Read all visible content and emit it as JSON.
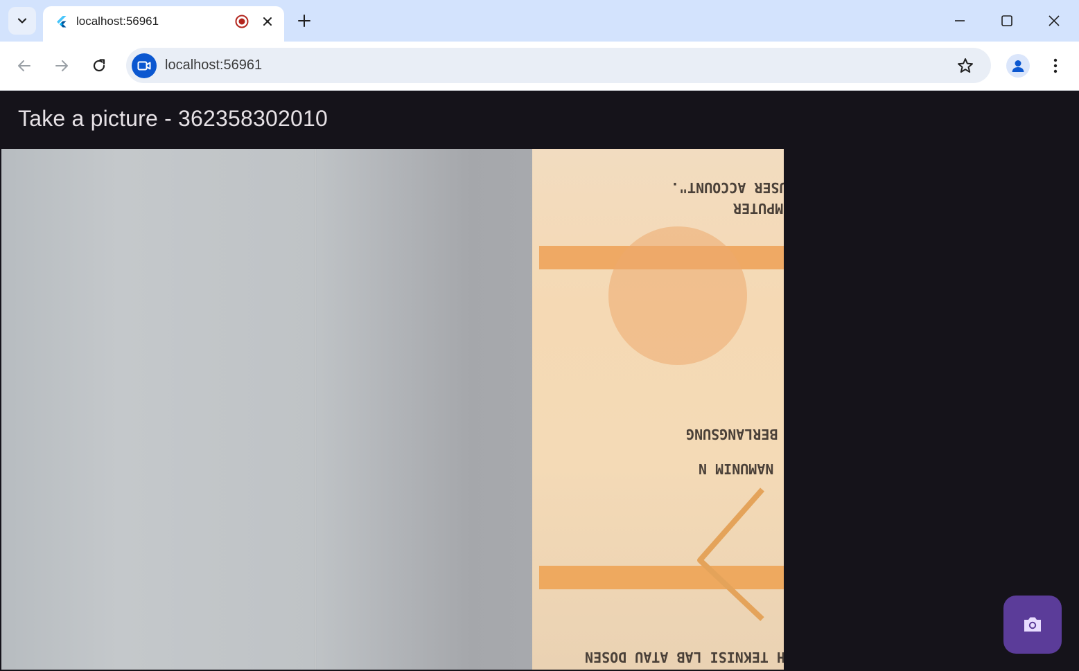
{
  "browser": {
    "tab_title": "localhost:56961",
    "url": "localhost:56961"
  },
  "app": {
    "title": "Take a picture - 362358302010"
  },
  "camera_preview": {
    "visible_document_lines": [
      "\" USER ACCOUNT\".",
      "OMPUTER",
      "N BERLANGSUNG",
      ") NAMUNIM N",
      "LEH TEKNISI LAB ATAU DOSEN"
    ]
  },
  "colors": {
    "tab_strip": "#d3e3fd",
    "app_background": "#15131a",
    "fab": "#5b3c99",
    "fab_icon": "#e8ddff",
    "site_chip": "#0b57d0"
  },
  "icons": {
    "tab_search": "chevron-down-icon",
    "favicon": "flutter-icon",
    "recording": "record-icon",
    "close_tab": "close-icon",
    "new_tab": "plus-icon",
    "back": "arrow-left-icon",
    "forward": "arrow-right-icon",
    "reload": "reload-icon",
    "camera_in_use": "video-camera-icon",
    "bookmark": "star-icon",
    "profile": "person-icon",
    "menu": "kebab-icon",
    "capture": "camera-icon"
  }
}
